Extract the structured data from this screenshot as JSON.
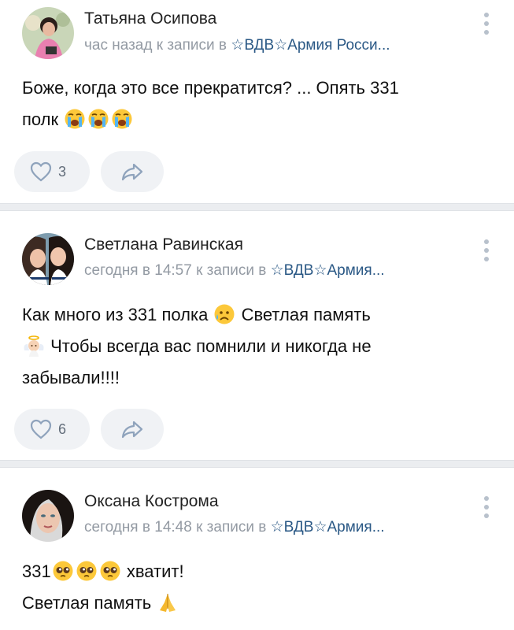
{
  "posts": [
    {
      "author": "Татьяна Осипова",
      "time": "час назад",
      "to_post": "к записи в",
      "group": "☆ВДВ☆Армия Росси...",
      "text_line1": "Боже, когда это все прекратится? ... Опять 331",
      "text_line2": "полк",
      "emojis": [
        "loudly-crying-face",
        "loudly-crying-face",
        "loudly-crying-face"
      ],
      "likes": "3"
    },
    {
      "author": "Светлана Равинская",
      "time": "сегодня в 14:57",
      "to_post": "к записи в",
      "group": "☆ВДВ☆Армия...",
      "text_line1a": "Как много из 331 полка",
      "text_line1b": "Светлая память",
      "text_line2": "Чтобы всегда вас помнили и никогда не",
      "text_line3": "забывали!!!!",
      "emojis": [
        "sad-but-relieved-face",
        "baby-angel"
      ],
      "likes": "6"
    },
    {
      "author": "Оксана Кострома",
      "time": "сегодня в 14:48",
      "to_post": "к записи в",
      "group": "☆ВДВ☆Армия...",
      "text_line1a": "331",
      "text_line1b": "хватит!",
      "text_line2": "Светлая память",
      "emojis": [
        "pleading-face",
        "pleading-face",
        "pleading-face",
        "folded-hands"
      ]
    }
  ],
  "colors": {
    "author": "#222222",
    "meta": "#939aa3",
    "group_link": "#2a5885",
    "button_bg": "#f0f2f5",
    "icon": "#8fa3bc",
    "separator": "#ebedf0"
  }
}
